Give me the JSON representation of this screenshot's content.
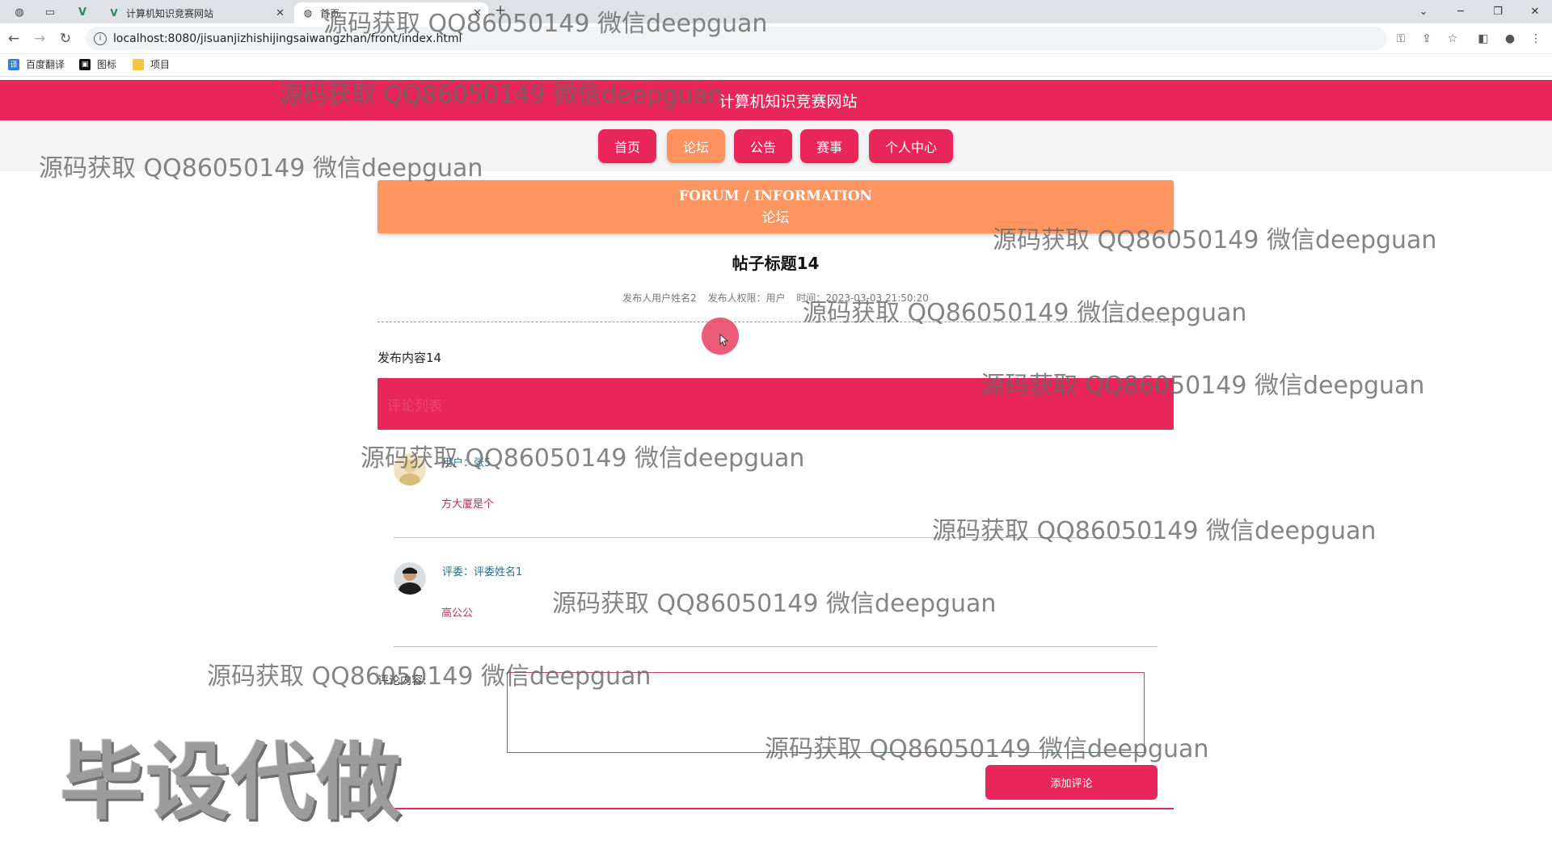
{
  "browser": {
    "tabs": [
      {
        "label": "计算机知识竞赛网站",
        "active": false
      },
      {
        "label": "首页",
        "active": true
      }
    ],
    "url": "localhost:8080/jisuanjizhishijingsaiwangzhan/front/index.html",
    "bookmarks": [
      "百度翻译",
      "图标",
      "项目"
    ]
  },
  "site": {
    "title": "计算机知识竞赛网站",
    "nav": [
      "首页",
      "论坛",
      "公告",
      "赛事",
      "个人中心"
    ],
    "active_nav": "论坛",
    "colors": {
      "primary": "#e8265a",
      "accent": "#ff9560"
    }
  },
  "banner": {
    "en": "FORUM / INFORMATION",
    "cn": "论坛"
  },
  "post": {
    "title": "帖子标题14",
    "meta_author": "发布人用户姓名2",
    "meta_role": "发布人权限：用户",
    "meta_time": "时间：2023-03-03 21:50:20",
    "content": "发布内容14"
  },
  "comments_header": "评论列表",
  "comments": [
    {
      "user": "用户：张5",
      "text": "方大厦是个"
    },
    {
      "user": "评委：评委姓名1",
      "text": "高公公"
    }
  ],
  "form": {
    "label": "评论内容:",
    "submit": "添加评论"
  },
  "watermark": "源码获取 QQ86050149 微信deepguan",
  "stamp": "毕设代做"
}
